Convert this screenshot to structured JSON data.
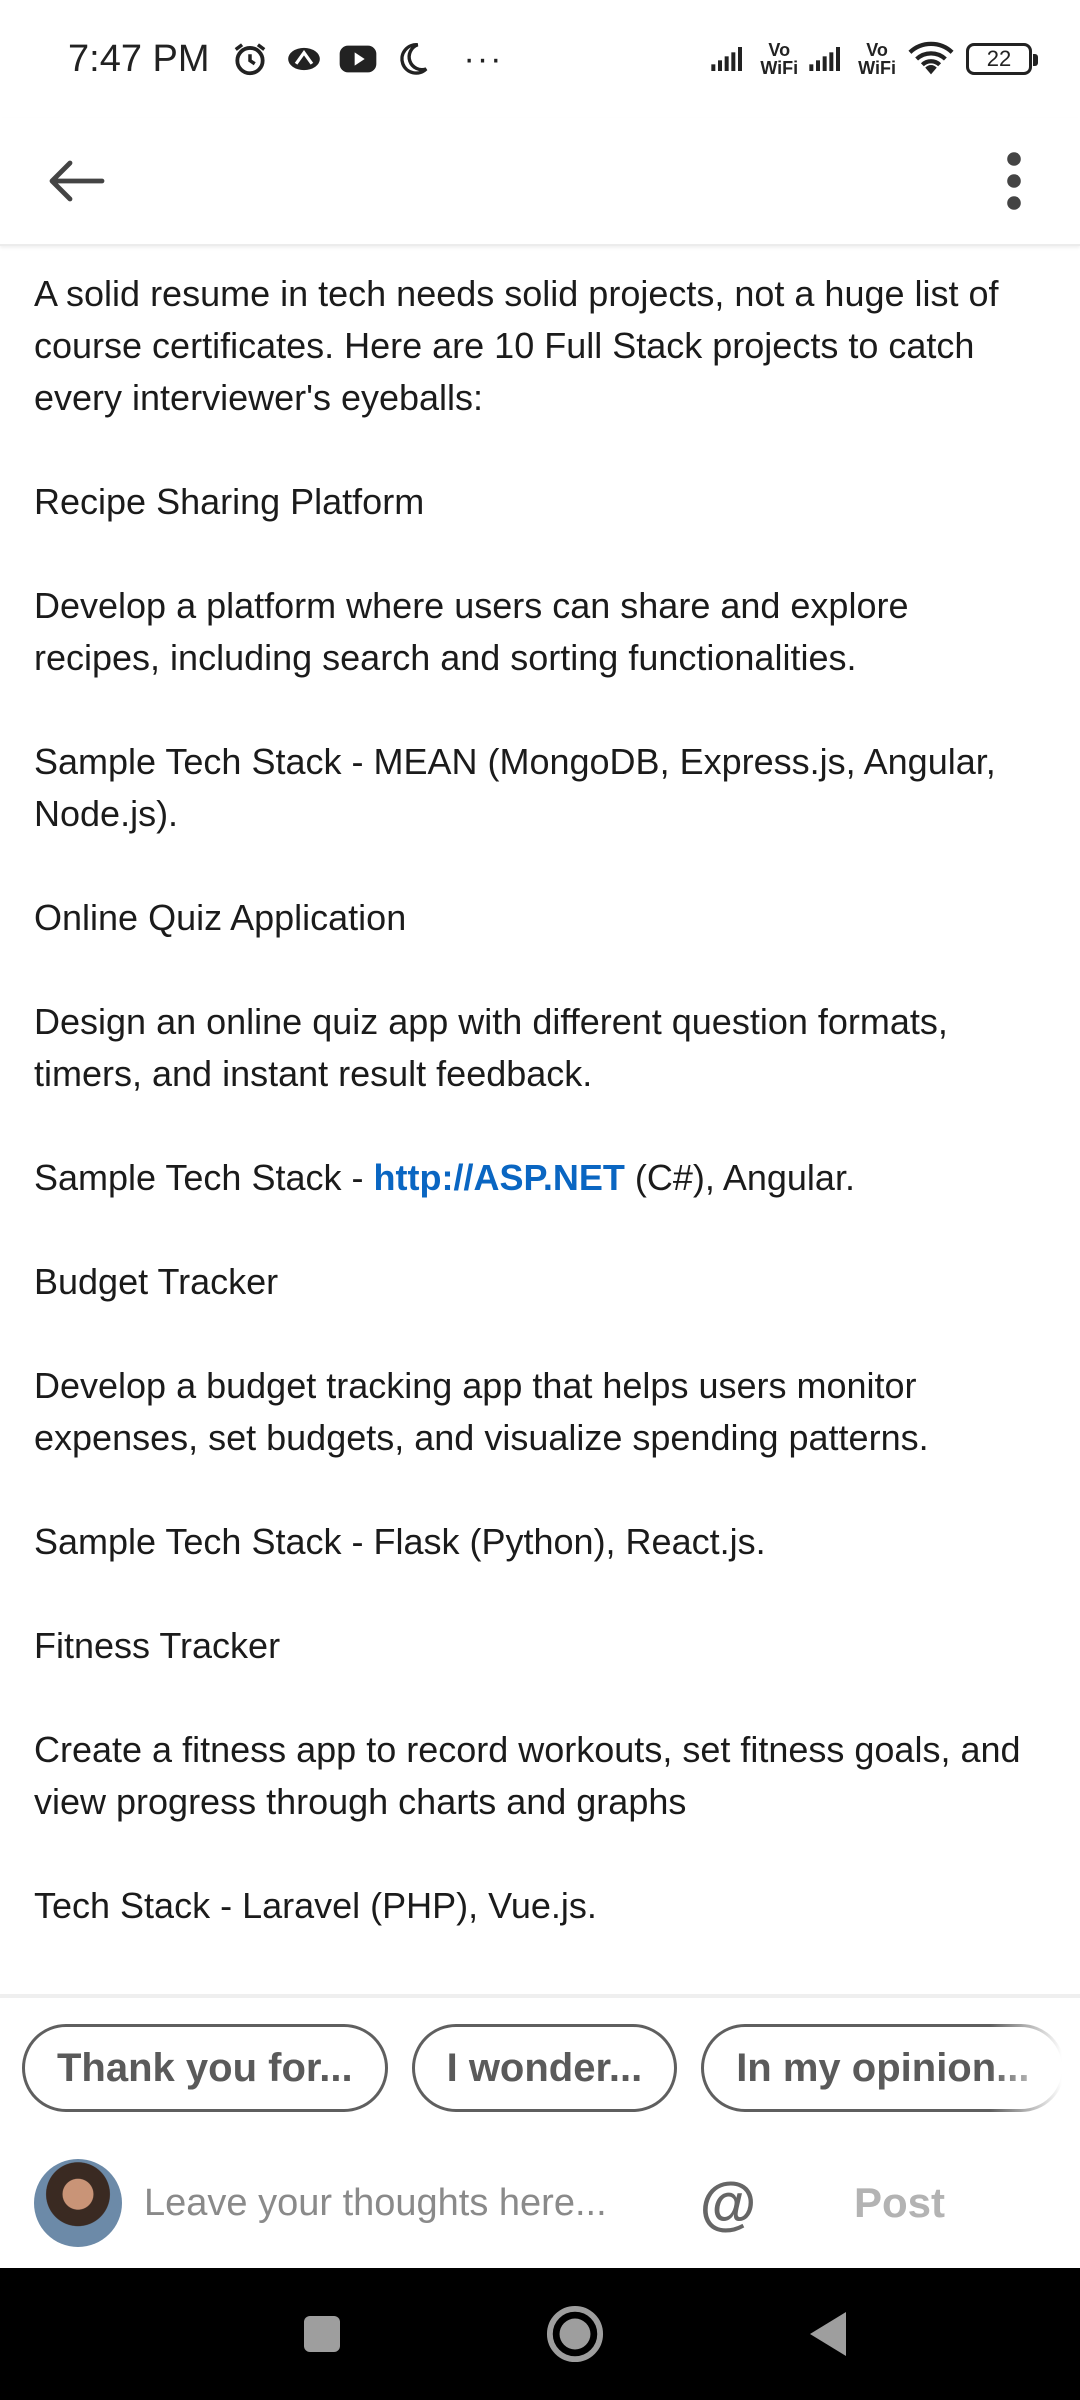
{
  "status_bar": {
    "time": "7:47 PM",
    "more": "···",
    "vowifi_1": "Vo\nWiFi",
    "vowifi_2": "Vo\nWiFi",
    "battery": "22"
  },
  "post": {
    "paragraphs": [
      "A solid resume in tech needs solid projects, not a huge list of course certificates. Here are 10 Full Stack projects to catch every interviewer's eyeballs:",
      "Recipe Sharing Platform",
      "Develop a platform where users can share and explore recipes, including search and sorting functionalities.",
      "Sample Tech Stack - MEAN (MongoDB, Express.js, Angular, Node.js).",
      "Online Quiz Application",
      "Design an online quiz app with different question formats, timers, and instant result feedback.",
      "Budget Tracker",
      "Develop a budget tracking app that helps users monitor expenses, set budgets, and visualize spending patterns.",
      "Sample Tech Stack - Flask (Python), React.js.",
      "Fitness Tracker",
      "Create a fitness app to record workouts, set fitness goals, and view progress through charts and graphs",
      "Tech Stack - Laravel (PHP), Vue.js."
    ],
    "quiz_stack": {
      "prefix": "Sample Tech Stack - ",
      "link": "http://ASP.NET",
      "suffix": " (C#), Angular."
    }
  },
  "suggestions": [
    "Thank you for...",
    "I wonder...",
    "In my opinion..."
  ],
  "composer": {
    "placeholder": "Leave your thoughts here...",
    "mention": "@",
    "post_label": "Post"
  }
}
